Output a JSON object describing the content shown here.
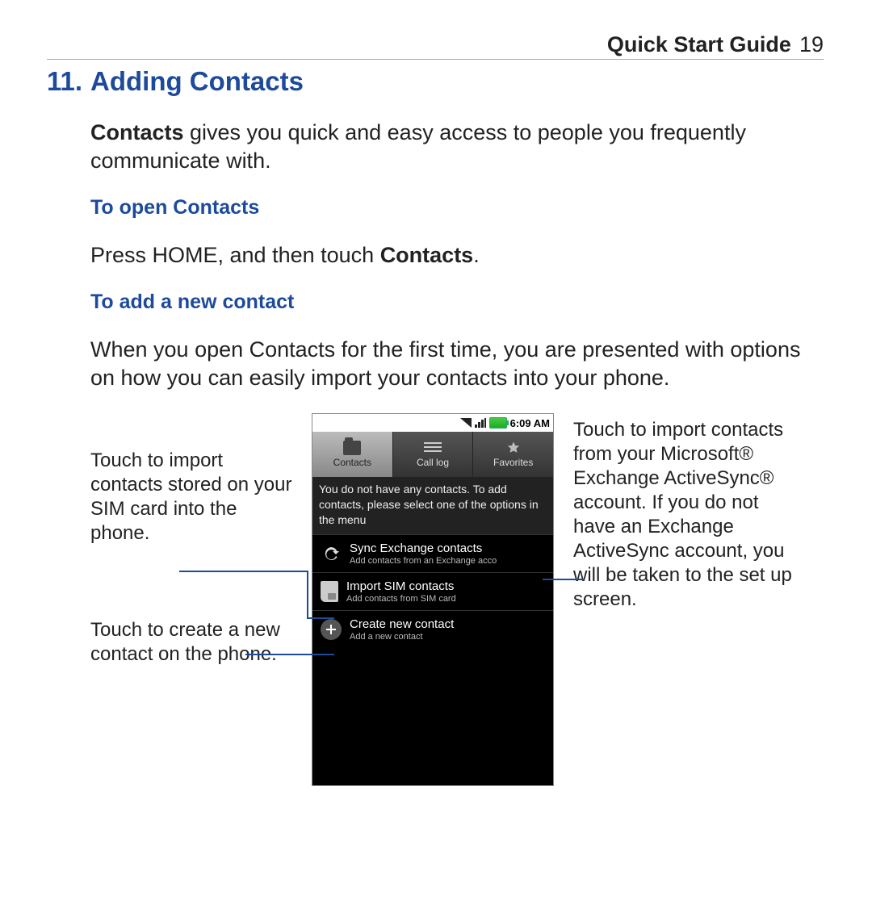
{
  "header": {
    "guide_title": "Quick Start Guide",
    "page_number": "19"
  },
  "section": {
    "number": "11.",
    "title": "Adding Contacts"
  },
  "intro": {
    "lead": "Contacts",
    "rest": " gives you quick and easy access to people you frequently communicate with."
  },
  "open": {
    "heading": "To open Contacts",
    "text_pre": "Press HOME, and then touch ",
    "text_bold": "Contacts",
    "text_post": "."
  },
  "add": {
    "heading": "To add a new contact",
    "text": "When you open Contacts for the first time, you are presented with options on how you can easily import your contacts into your phone."
  },
  "callouts": {
    "sim": "Touch to import contacts stored on your SIM card into the phone.",
    "create": "Touch to create a new contact on the phone.",
    "exchange": "Touch to import contacts from your Microsoft® Exchange ActiveSync® account. If you do not have an Exchange ActiveSync account, you will be taken to the set up screen."
  },
  "phone": {
    "time": "6:09 AM",
    "tabs": {
      "contacts": "Contacts",
      "calllog": "Call log",
      "favorites": "Favorites"
    },
    "message": "You do not have any contacts. To add contacts, please select one of the options in the menu",
    "items": {
      "sync": {
        "title": "Sync Exchange contacts",
        "sub": "Add contacts from an Exchange acco"
      },
      "sim": {
        "title": "Import SIM contacts",
        "sub": "Add contacts from SIM card"
      },
      "create": {
        "title": "Create new contact",
        "sub": "Add a new contact"
      }
    }
  }
}
